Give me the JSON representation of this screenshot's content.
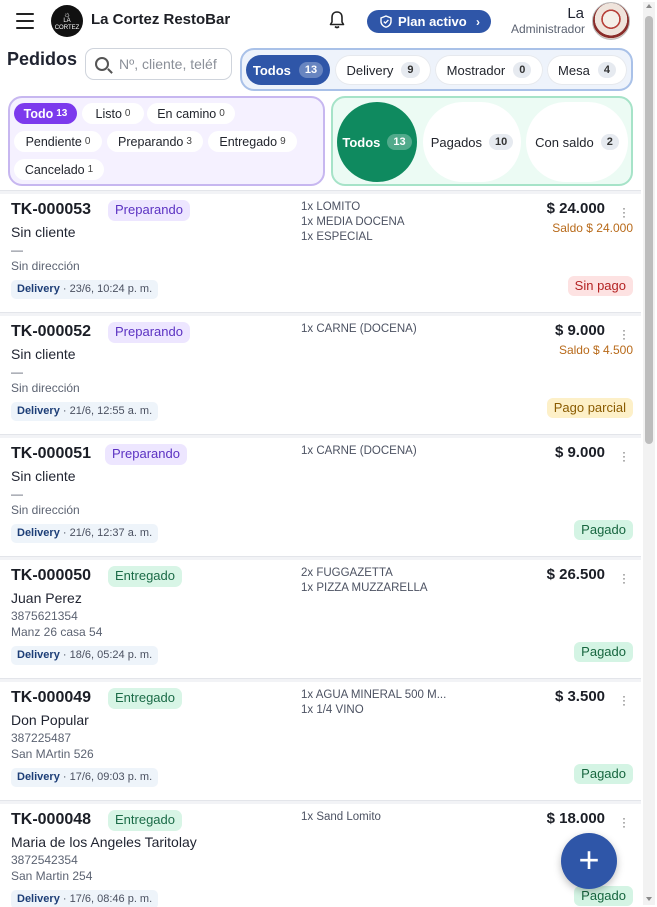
{
  "header": {
    "brand": "La Cortez RestoBar",
    "logo_text": "LA CORTEZ",
    "plan_label": "Plan activo",
    "user_name": "La",
    "user_role": "Administrador"
  },
  "page": {
    "title": "Pedidos",
    "search_placeholder": "Nº, cliente, teléf"
  },
  "type_filters": [
    {
      "label": "Todos",
      "count": "13",
      "active": true
    },
    {
      "label": "Delivery",
      "count": "9",
      "active": false
    },
    {
      "label": "Mostrador",
      "count": "0",
      "active": false
    },
    {
      "label": "Mesa",
      "count": "4",
      "active": false
    }
  ],
  "status_filters": [
    {
      "label": "Todo",
      "count": "13",
      "active": true
    },
    {
      "label": "Listo",
      "count": "0",
      "active": false
    },
    {
      "label": "En camino",
      "count": "0",
      "active": false
    },
    {
      "label": "Pendiente",
      "count": "0",
      "active": false
    },
    {
      "label": "Preparando",
      "count": "3",
      "active": false
    },
    {
      "label": "Entregado",
      "count": "9",
      "active": false
    },
    {
      "label": "Cancelado",
      "count": "1",
      "active": false
    }
  ],
  "payment_filters": [
    {
      "label": "Todos",
      "count": "13",
      "active": true
    },
    {
      "label": "Pagados",
      "count": "10",
      "active": false
    },
    {
      "label": "Con saldo",
      "count": "2",
      "active": false
    }
  ],
  "orders": [
    {
      "id": "TK-000053",
      "status": "Preparando",
      "client": "Sin cliente",
      "phone": "—",
      "address": "Sin dirección",
      "type": "Delivery",
      "date": "23/6, 10:24 p. m.",
      "items": [
        "1x LOMITO",
        "1x MEDIA DOCENA",
        "1x ESPECIAL"
      ],
      "total": "$ 24.000",
      "saldo": "Saldo $ 24.000",
      "payment": "Sin pago"
    },
    {
      "id": "TK-000052",
      "status": "Preparando",
      "client": "Sin cliente",
      "phone": "—",
      "address": "Sin dirección",
      "type": "Delivery",
      "date": "21/6, 12:55 a. m.",
      "items": [
        "1x CARNE (DOCENA)"
      ],
      "total": "$ 9.000",
      "saldo": "Saldo $ 4.500",
      "payment": "Pago parcial"
    },
    {
      "id": "TK-000051",
      "status": "Preparando",
      "client": "Sin cliente",
      "phone": "—",
      "address": "Sin dirección",
      "type": "Delivery",
      "date": "21/6, 12:37 a. m.",
      "items": [
        "1x CARNE (DOCENA)"
      ],
      "total": "$ 9.000",
      "saldo": "",
      "payment": "Pagado"
    },
    {
      "id": "TK-000050",
      "status": "Entregado",
      "client": "Juan Perez",
      "phone": "3875621354",
      "address": "Manz 26 casa 54",
      "type": "Delivery",
      "date": "18/6, 05:24 p. m.",
      "items": [
        "2x FUGGAZETTA",
        "1x PIZZA MUZZARELLA"
      ],
      "total": "$ 26.500",
      "saldo": "",
      "payment": "Pagado"
    },
    {
      "id": "TK-000049",
      "status": "Entregado",
      "client": "Don Popular",
      "phone": "387225487",
      "address": "San MArtin 526",
      "type": "Delivery",
      "date": "17/6, 09:03 p. m.",
      "items": [
        "1x AGUA MINERAL 500 M...",
        "1x 1/4 VINO"
      ],
      "total": "$ 3.500",
      "saldo": "",
      "payment": "Pagado"
    },
    {
      "id": "TK-000048",
      "status": "Entregado",
      "client": "Maria de los Angeles Taritolay",
      "phone": "3872542354",
      "address": "San Martin 254",
      "type": "Delivery",
      "date": "17/6, 08:46 p. m.",
      "items": [
        "1x Sand Lomito"
      ],
      "total": "$ 18.000",
      "saldo": "",
      "payment": "Pagado"
    }
  ],
  "fab_label": "+"
}
